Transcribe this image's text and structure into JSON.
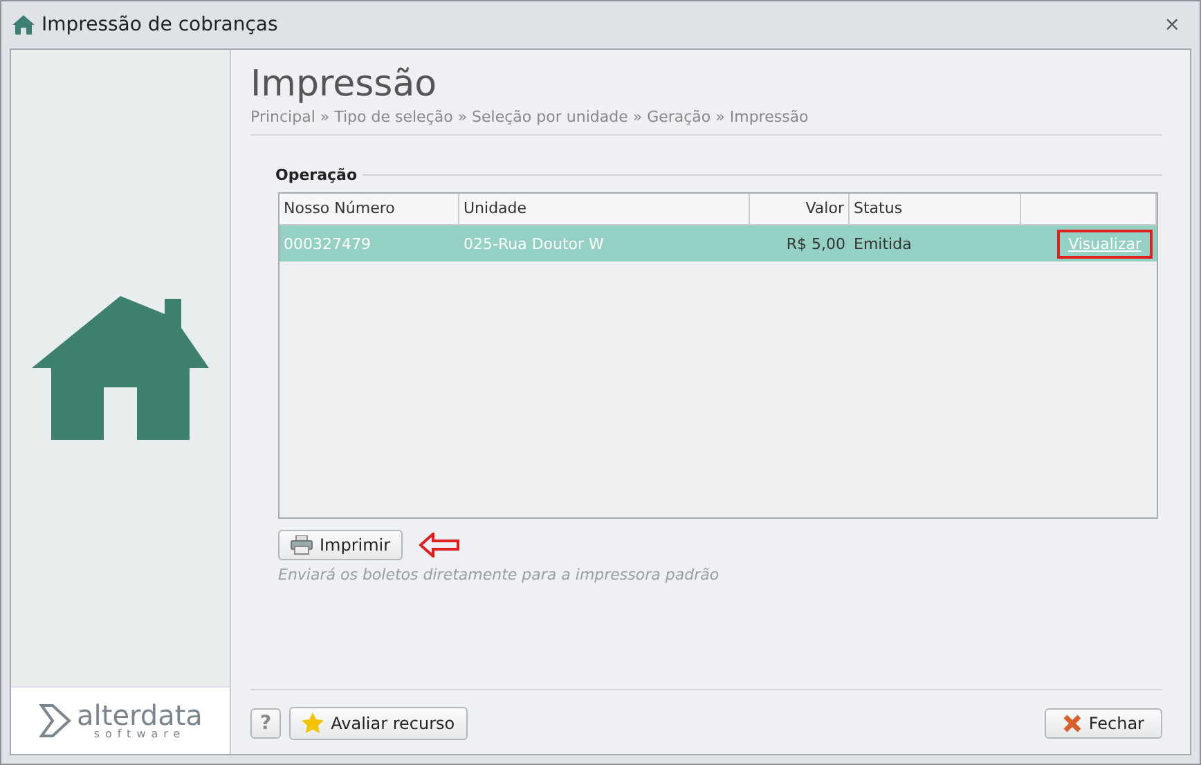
{
  "window": {
    "title": "Impressão de cobranças",
    "close": "×"
  },
  "header": {
    "title": "Impressão",
    "breadcrumb": "Principal » Tipo de seleção » Seleção por unidade » Geração » Impressão"
  },
  "sidebar": {
    "logo": "alterdata",
    "logo_sub": "software"
  },
  "group": {
    "title": "Operação"
  },
  "table": {
    "columns": [
      "Nosso Número",
      "Unidade",
      "Valor",
      "Status"
    ],
    "rows": [
      {
        "cells": [
          "000327479",
          "025-Rua Doutor W",
          "R$ 5,00",
          "Emitida"
        ],
        "link": "Visualizar",
        "selected": true,
        "highlighted_link": true
      }
    ]
  },
  "print": {
    "label": "Imprimir",
    "hint": "Enviará os boletos diretamente para a impressora padrão",
    "arrow": true
  },
  "footer": {
    "help": "?",
    "rate": "Avaliar recurso",
    "close": "Fechar"
  }
}
